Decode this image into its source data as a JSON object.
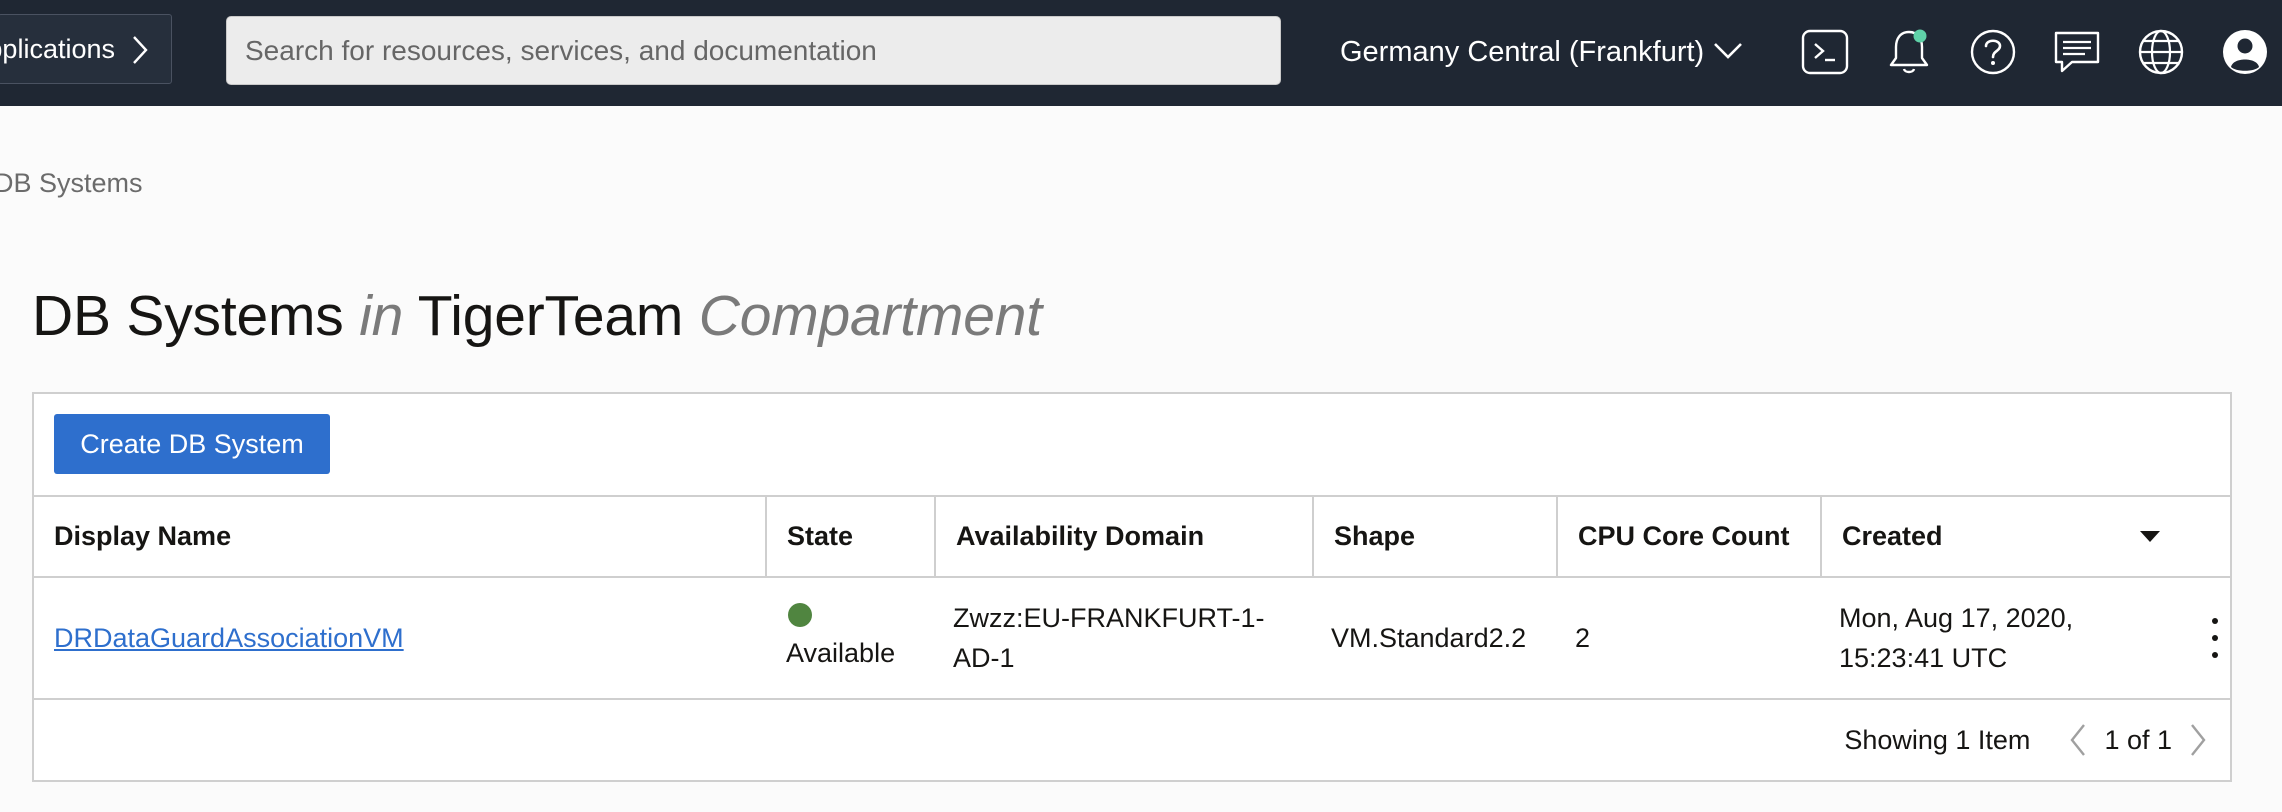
{
  "topbar": {
    "apps_label": "Applications",
    "search_placeholder": "Search for resources, services, and documentation",
    "region_label": "Germany Central (Frankfurt)",
    "notification_dot_color": "#5fd1a8",
    "icons": [
      "cloud-shell-icon",
      "bell-icon",
      "help-icon",
      "chat-icon",
      "globe-icon",
      "user-icon"
    ]
  },
  "breadcrumb": {
    "current": "DB Systems"
  },
  "title": {
    "main": "DB Systems",
    "connector": "in",
    "compartment": "TigerTeam",
    "suffix": "Compartment"
  },
  "toolbar": {
    "create_label": "Create DB System"
  },
  "table": {
    "headers": {
      "name": "Display Name",
      "state": "State",
      "ad": "Availability Domain",
      "shape": "Shape",
      "cpu": "CPU Core Count",
      "created": "Created"
    },
    "rows": [
      {
        "name": "DRDataGuardAssociationVM",
        "state": "Available",
        "state_color": "#508540",
        "ad_line1": "Zwzz:EU-FRANKFURT-1-",
        "ad_line2": "AD-1",
        "shape": "VM.Standard2.2",
        "cpu": "2",
        "created_line1": "Mon, Aug 17, 2020,",
        "created_line2": "15:23:41 UTC"
      }
    ]
  },
  "footer": {
    "showing": "Showing 1 Item",
    "page_info": "1 of 1"
  },
  "colors": {
    "topbar_bg": "#1f2733",
    "primary_button": "#2e6fcd",
    "link": "#2e6fcd"
  }
}
